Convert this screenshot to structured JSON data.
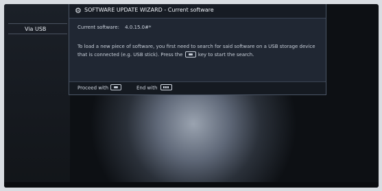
{
  "sidebar": {
    "items": [
      {
        "label": "Via USB"
      }
    ]
  },
  "dialog": {
    "icon": "gear-icon",
    "title": "SOFTWARE UPDATE WIZARD - Current software",
    "current_label": "Current software:",
    "current_value": "4.0.15.0#*",
    "instruction_before_key": "To load a new piece of software, you first need to search for said software on a USB storage device that is connected (e.g. USB stick). Press the",
    "instruction_after_key": "key to start the search.",
    "footer": {
      "proceed_label": "Proceed with",
      "end_label": "End with"
    }
  },
  "colors": {
    "dialog_bg": "#202733",
    "titlebar_bg": "#171c24",
    "text": "#c9d0da"
  }
}
